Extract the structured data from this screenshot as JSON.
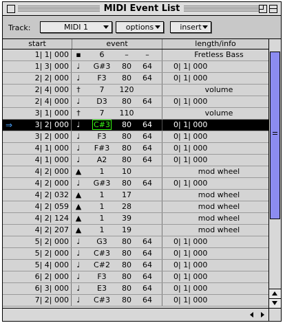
{
  "window": {
    "title": "MIDI Event List"
  },
  "toolbar": {
    "track_label": "Track:",
    "track_value": "MIDI 1",
    "options_label": "options",
    "insert_label": "insert"
  },
  "headers": {
    "start": "start",
    "event": "event",
    "length_info": "length/info"
  },
  "icons": {
    "note": "♩",
    "controller": "†",
    "aftertouch": "▲",
    "program": "▪",
    "cursor": "⇒"
  },
  "colors": {
    "selection_bg": "#000000",
    "selection_note_text": "#39ff14",
    "scroll_thumb": "#8c8cf0",
    "cursor_arrow": "#4aa3ff"
  },
  "rows": [
    {
      "start": "1| 1| 000",
      "type": "program",
      "note": "6",
      "v1": "–",
      "v2": "–",
      "info": "Fretless Bass",
      "info_kind": "txt"
    },
    {
      "start": "1| 3| 000",
      "type": "note",
      "note": "G#3",
      "v1": "80",
      "v2": "64",
      "info": "0| 1| 000",
      "info_kind": "len"
    },
    {
      "start": "2| 2| 000",
      "type": "note",
      "note": "F3",
      "v1": "80",
      "v2": "64",
      "info": "0| 1| 000",
      "info_kind": "len"
    },
    {
      "start": "2| 4| 000",
      "type": "controller",
      "note": "7",
      "v1": "120",
      "v2": "",
      "info": "volume",
      "info_kind": "txt"
    },
    {
      "start": "2| 4| 000",
      "type": "note",
      "note": "D3",
      "v1": "80",
      "v2": "64",
      "info": "0| 1| 000",
      "info_kind": "len"
    },
    {
      "start": "3| 1| 000",
      "type": "controller",
      "note": "7",
      "v1": "110",
      "v2": "",
      "info": "volume",
      "info_kind": "txt"
    },
    {
      "start": "3| 2| 000",
      "type": "note",
      "note": "C#3",
      "v1": "80",
      "v2": "64",
      "info": "0| 1| 000",
      "info_kind": "len",
      "selected": true
    },
    {
      "start": "3| 2| 000",
      "type": "note",
      "note": "F3",
      "v1": "80",
      "v2": "64",
      "info": "0| 1| 000",
      "info_kind": "len"
    },
    {
      "start": "4| 1| 000",
      "type": "note",
      "note": "F#3",
      "v1": "80",
      "v2": "64",
      "info": "0| 1| 000",
      "info_kind": "len"
    },
    {
      "start": "4| 1| 000",
      "type": "note",
      "note": "A2",
      "v1": "80",
      "v2": "64",
      "info": "0| 1| 000",
      "info_kind": "len"
    },
    {
      "start": "4| 2| 000",
      "type": "aftertouch",
      "note": "1",
      "v1": "10",
      "v2": "",
      "info": "mod wheel",
      "info_kind": "txt"
    },
    {
      "start": "4| 2| 000",
      "type": "note",
      "note": "G#3",
      "v1": "80",
      "v2": "64",
      "info": "0| 1| 000",
      "info_kind": "len"
    },
    {
      "start": "4| 2| 032",
      "type": "aftertouch",
      "note": "1",
      "v1": "17",
      "v2": "",
      "info": "mod wheel",
      "info_kind": "txt"
    },
    {
      "start": "4| 2| 059",
      "type": "aftertouch",
      "note": "1",
      "v1": "28",
      "v2": "",
      "info": "mod wheel",
      "info_kind": "txt"
    },
    {
      "start": "4| 2| 124",
      "type": "aftertouch",
      "note": "1",
      "v1": "39",
      "v2": "",
      "info": "mod wheel",
      "info_kind": "txt"
    },
    {
      "start": "4| 2| 207",
      "type": "aftertouch",
      "note": "1",
      "v1": "19",
      "v2": "",
      "info": "mod wheel",
      "info_kind": "txt"
    },
    {
      "start": "5| 2| 000",
      "type": "note",
      "note": "G3",
      "v1": "80",
      "v2": "64",
      "info": "0| 1| 000",
      "info_kind": "len"
    },
    {
      "start": "5| 2| 000",
      "type": "note",
      "note": "C#3",
      "v1": "80",
      "v2": "64",
      "info": "0| 1| 000",
      "info_kind": "len"
    },
    {
      "start": "5| 4| 000",
      "type": "note",
      "note": "C#2",
      "v1": "80",
      "v2": "64",
      "info": "0| 1| 000",
      "info_kind": "len"
    },
    {
      "start": "6| 2| 000",
      "type": "note",
      "note": "F3",
      "v1": "80",
      "v2": "64",
      "info": "0| 1| 000",
      "info_kind": "len"
    },
    {
      "start": "6| 3| 000",
      "type": "note",
      "note": "E3",
      "v1": "80",
      "v2": "64",
      "info": "0| 1| 000",
      "info_kind": "len"
    },
    {
      "start": "7| 2| 000",
      "type": "note",
      "note": "C#3",
      "v1": "80",
      "v2": "64",
      "info": "0| 1| 000",
      "info_kind": "len"
    }
  ]
}
